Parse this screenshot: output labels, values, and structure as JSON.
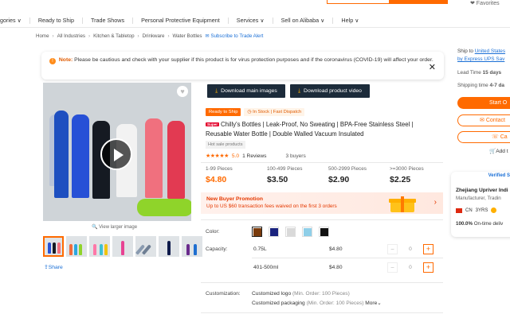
{
  "topbar": {
    "account": "❤ Favorites"
  },
  "nav": {
    "items": [
      "gories ∨",
      "Ready to Ship",
      "Trade Shows",
      "Personal Protective Equipment",
      "Services ∨",
      "Sell on Alibaba ∨",
      "Help ∨"
    ]
  },
  "breadcrumb": {
    "items": [
      "Home",
      "All Industries",
      "Kitchen & Tabletop",
      "Drinkware",
      "Water Bottles"
    ],
    "subscribe": "Subscribe to Trade Alert"
  },
  "notice": {
    "label": "Note:",
    "text": "Please be cautious and check with your supplier if this product is for virus protection purposes and if the coronavirus (COVID-19) will affect your order."
  },
  "gallery": {
    "view_larger": "View larger image",
    "share": "Share"
  },
  "downloads": {
    "main_images": "Download main images",
    "product_video": "Download product video"
  },
  "badges": {
    "ready": "Ready to Ship",
    "stock": "In Stock",
    "dispatch": "Fast Dispatch"
  },
  "product": {
    "super_tag": "Super",
    "title": "Chilly's Bottles | Leak-Proof, No Sweating | BPA-Free Stainless Steel | Reusable Water Bottle | Double Walled Vacuum Insulated",
    "hot_tag": "Hot sale products",
    "rating": "5.0",
    "reviews": "1 Reviews",
    "buyers": "3 buyers"
  },
  "tiers": [
    {
      "range": "1-99 Pieces",
      "price": "$4.80"
    },
    {
      "range": "100-499 Pieces",
      "price": "$3.50"
    },
    {
      "range": "500-2999 Pieces",
      "price": "$2.90"
    },
    {
      "range": ">=3000 Pieces",
      "price": "$2.25"
    }
  ],
  "promo": {
    "title": "New Buyer Promotion",
    "subtitle": "Up to US $60 transaction fees waived on the first 3 orders"
  },
  "options": {
    "color_label": "Color:",
    "colors": [
      "#7a3b0c",
      "#1a237e",
      "#d9d9d9",
      "#8fcfe8",
      "#111111"
    ],
    "capacity_label": "Capacity:",
    "capacities": [
      {
        "value": "0.75L",
        "price": "$4.80",
        "qty": "0"
      },
      {
        "value": "401-500ml",
        "price": "$4.80",
        "qty": "0"
      }
    ]
  },
  "customization": {
    "label": "Customization:",
    "logo": "Customized logo",
    "logo_min": "(Min. Order: 100 Pieces)",
    "packaging": "Customized packaging",
    "packaging_min": "(Min. Order: 100 Pieces)",
    "more": "More"
  },
  "sidebar": {
    "ship_to": "Ship to",
    "ship_country": "United States",
    "ship_by": "by Express UPS Sav",
    "lead_time_label": "Lead Time",
    "lead_time_value": "15 days",
    "shipping_label": "Shipping time",
    "shipping_value": "4-7 da",
    "start_order": "Start O",
    "contact": "Contact",
    "call": "Ca",
    "add": "Add t"
  },
  "supplier": {
    "verified": "Verified S",
    "name": "Zhejiang Upriver Indi",
    "role": "Manufacturer, Tradin",
    "country": "CN",
    "years": "3YRS",
    "otd_value": "100.0%",
    "otd_label": "On-time deliv"
  }
}
